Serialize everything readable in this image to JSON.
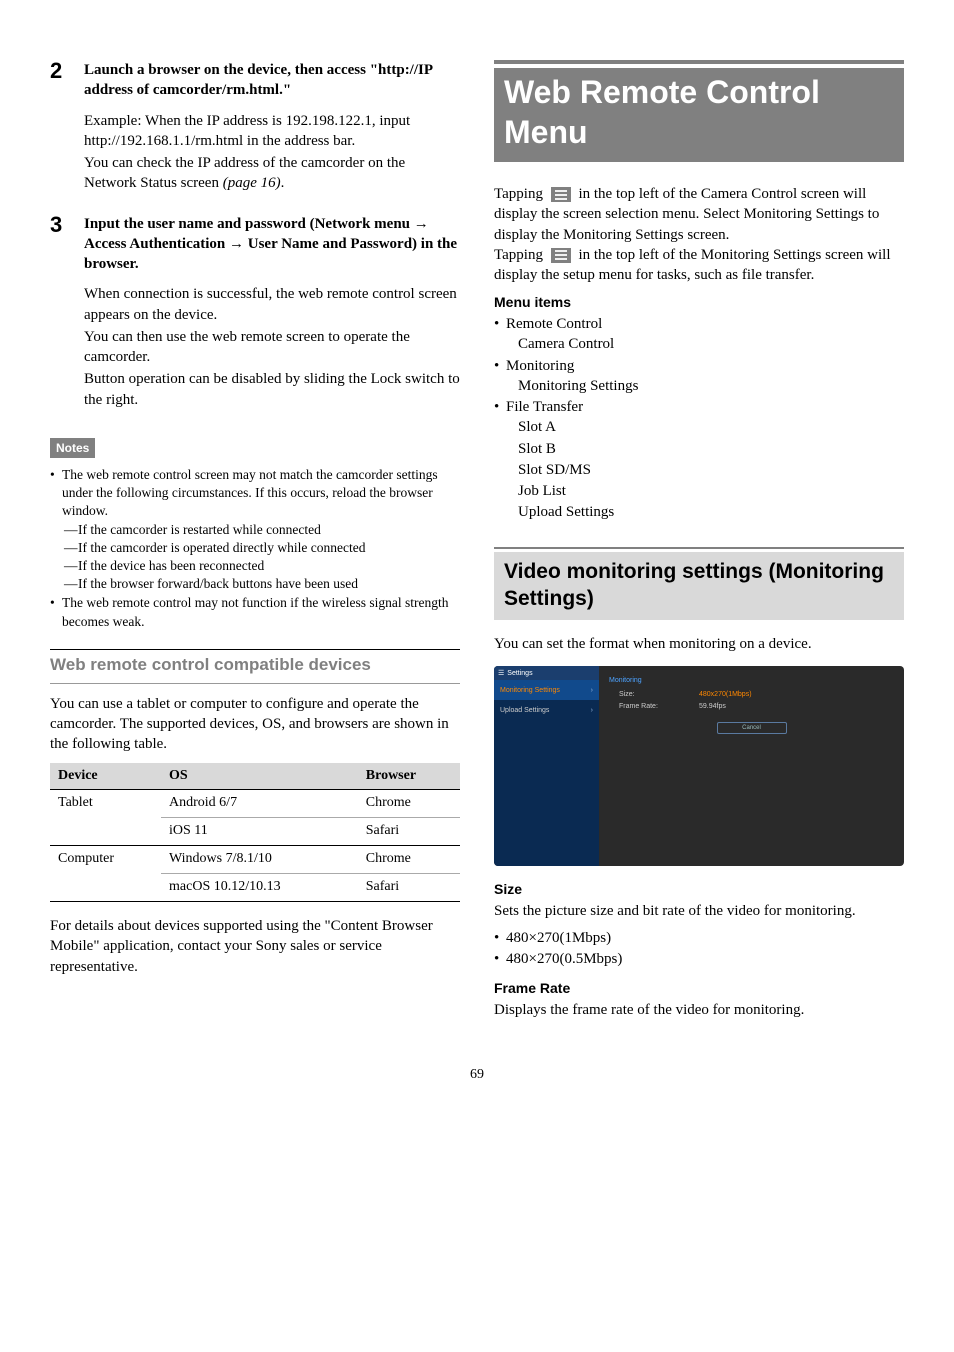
{
  "left": {
    "step2": {
      "num": "2",
      "title": "Launch a browser on the device, then access \"http://IP address of camcorder/rm.html.\"",
      "line1": "Example: When the IP address is 192.198.122.1, input http://192.168.1.1/rm.html in the address bar.",
      "line2": "You can check the IP address of the camcorder on the Network Status screen ",
      "pageref": "(page 16)",
      "period": "."
    },
    "step3": {
      "num": "3",
      "title_parts": {
        "a": "Input the user name and password (Network menu ",
        "arrow1": "→",
        "b": " Access Authentication ",
        "arrow2": "→",
        "c": " User Name and Password) in the browser."
      },
      "line1": "When connection is successful, the web remote control screen appears on the device.",
      "line2": "You can then use the web remote screen to operate the camcorder.",
      "line3": "Button operation can be disabled by sliding the Lock switch to the right."
    },
    "notes_label": "Notes",
    "notes": {
      "b1": "The web remote control screen may not match the camcorder settings under the following circumstances. If this occurs, reload the browser window.",
      "sub1": "If the camcorder is restarted while connected",
      "sub2": "If the camcorder is operated directly while connected",
      "sub3": "If the device has been reconnected",
      "sub4": "If the browser forward/back buttons have been used",
      "b2": "The web remote control may not function if the wireless signal strength becomes weak."
    },
    "compat_heading": "Web remote control compatible devices",
    "compat_intro": "You can use a tablet or computer to configure and operate the camcorder. The supported devices, OS, and browsers are shown in the following table.",
    "table": {
      "h1": "Device",
      "h2": "OS",
      "h3": "Browser",
      "r1": {
        "device": "Tablet",
        "os": "Android 6/7",
        "browser": "Chrome"
      },
      "r2": {
        "device": "",
        "os": "iOS 11",
        "browser": "Safari"
      },
      "r3": {
        "device": "Computer",
        "os": "Windows 7/8.1/10",
        "browser": "Chrome"
      },
      "r4": {
        "device": "",
        "os": "macOS 10.12/10.13",
        "browser": "Safari"
      }
    },
    "compat_outro": "For details about devices supported using the \"Content Browser Mobile\" application, contact your Sony sales or service representative."
  },
  "right": {
    "big_heading": "Web Remote Control Menu",
    "intro": {
      "a": "Tapping ",
      "b": " in the top left of the Camera Control screen will display the screen selection menu. Select Monitoring Settings to display the Monitoring Settings screen.",
      "c": "Tapping ",
      "d": " in the top left of the Monitoring Settings screen will display the setup menu for tasks, such as file transfer."
    },
    "menu_items_heading": "Menu items",
    "menu_items": {
      "g1": "Remote Control",
      "g1s": "Camera Control",
      "g2": "Monitoring",
      "g2s": "Monitoring Settings",
      "g3": "File Transfer",
      "g3s1": "Slot A",
      "g3s2": "Slot B",
      "g3s3": "Slot SD/MS",
      "g3s4": "Job List",
      "g3s5": "Upload Settings"
    },
    "section_heading": "Video monitoring settings (Monitoring Settings)",
    "section_intro": "You can set the format when monitoring on a device.",
    "screenshot": {
      "header": "Settings",
      "side1": "Monitoring Settings",
      "side2": "Upload Settings",
      "sect": "Monitoring",
      "row1l": "Size:",
      "row1v": "480x270(1Mbps)",
      "row2l": "Frame Rate:",
      "row2v": "59.94fps",
      "cancel": "Cancel"
    },
    "size_heading": "Size",
    "size_text": "Sets the picture size and bit rate of the video for monitoring.",
    "size_opt1": "480×270(1Mbps)",
    "size_opt2": "480×270(0.5Mbps)",
    "frame_heading": "Frame Rate",
    "frame_text": "Displays the frame rate of the video for monitoring."
  },
  "page_number": "69"
}
